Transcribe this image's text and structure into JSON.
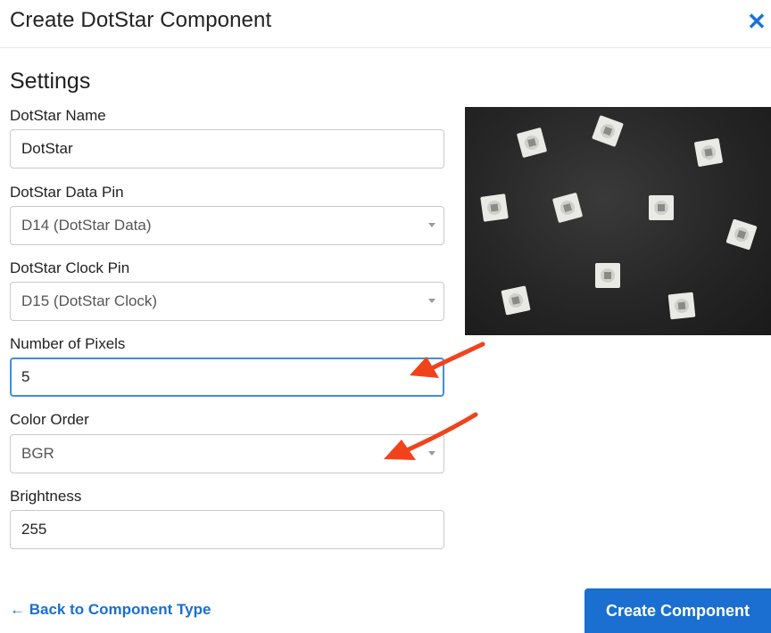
{
  "header": {
    "title": "Create DotStar Component",
    "close_icon": "close-icon"
  },
  "settings": {
    "title": "Settings",
    "name": {
      "label": "DotStar Name",
      "value": "DotStar"
    },
    "data_pin": {
      "label": "DotStar Data Pin",
      "value": "D14 (DotStar Data)"
    },
    "clock_pin": {
      "label": "DotStar Clock Pin",
      "value": "D15 (DotStar Clock)"
    },
    "num_pixels": {
      "label": "Number of Pixels",
      "value": "5"
    },
    "color_order": {
      "label": "Color Order",
      "value": "BGR"
    },
    "brightness": {
      "label": "Brightness",
      "value": "255"
    }
  },
  "footer": {
    "back_label": "← Back to Component Type",
    "create_label": "Create Component"
  },
  "colors": {
    "accent": "#1a6fd0",
    "annotation_arrow": "#f0431c",
    "focus_border": "#3f8fde"
  }
}
